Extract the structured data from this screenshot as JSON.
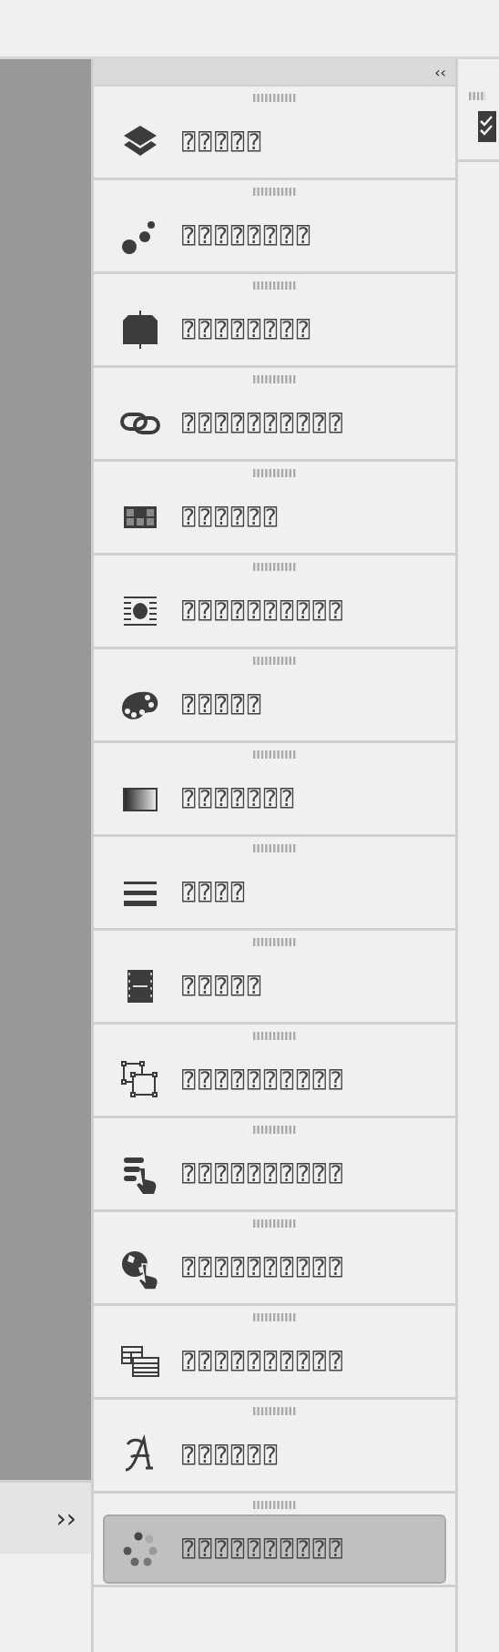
{
  "panel": {
    "collapse_button": "‹‹",
    "items": [
      {
        "label": "⍰⍰⍰⍰⍰",
        "selected": false
      },
      {
        "label": "⍰⍰⍰⍰⍰⍰⍰⍰",
        "selected": false
      },
      {
        "label": "⍰⍰⍰⍰⍰⍰⍰⍰",
        "selected": false
      },
      {
        "label": "⍰⍰⍰⍰⍰⍰⍰⍰⍰⍰",
        "selected": false
      },
      {
        "label": "⍰⍰⍰⍰⍰⍰",
        "selected": false
      },
      {
        "label": "⍰⍰⍰⍰⍰⍰⍰⍰⍰⍰",
        "selected": false
      },
      {
        "label": "⍰⍰⍰⍰⍰",
        "selected": false
      },
      {
        "label": "⍰⍰⍰⍰⍰⍰⍰",
        "selected": false
      },
      {
        "label": "⍰⍰⍰⍰",
        "selected": false
      },
      {
        "label": "⍰⍰⍰⍰⍰",
        "selected": false
      },
      {
        "label": "⍰⍰⍰⍰⍰⍰⍰⍰⍰⍰",
        "selected": false
      },
      {
        "label": "⍰⍰⍰⍰⍰⍰⍰⍰⍰⍰",
        "selected": false
      },
      {
        "label": "⍰⍰⍰⍰⍰⍰⍰⍰⍰⍰",
        "selected": false
      },
      {
        "label": "⍰⍰⍰⍰⍰⍰⍰⍰⍰⍰",
        "selected": false
      },
      {
        "label": "⍰⍰⍰⍰⍰⍰",
        "selected": false
      },
      {
        "label": "⍰⍰⍰⍰⍰⍰⍰⍰⍰⍰",
        "selected": true
      }
    ]
  },
  "expand_button": "››"
}
